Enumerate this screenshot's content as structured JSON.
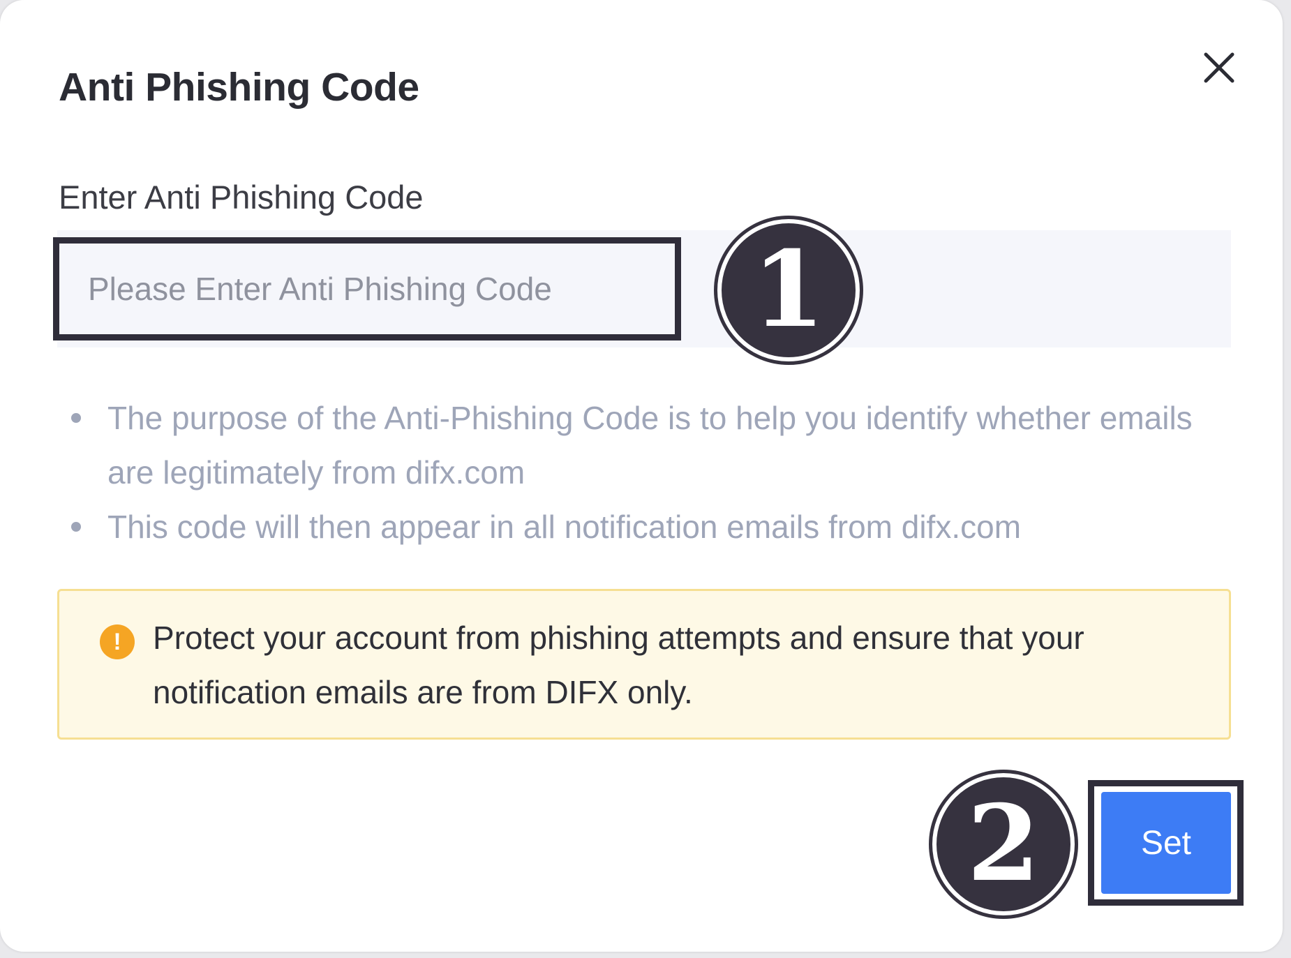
{
  "dialog": {
    "title": "Anti Phishing Code",
    "close_icon": "close-icon"
  },
  "form": {
    "label": "Enter Anti Phishing Code",
    "input_value": "",
    "input_placeholder": "Please Enter Anti Phishing Code"
  },
  "info": {
    "items": [
      "The purpose of the Anti-Phishing Code is to help you identify whether emails are legitimately from difx.com",
      "This code will then appear in all notification emails from difx.com"
    ]
  },
  "warning": {
    "icon": "warning-icon",
    "icon_glyph": "!",
    "text": "Protect your account from phishing attempts and ensure that your notification emails are from DIFX only."
  },
  "actions": {
    "set_label": "Set"
  },
  "annotations": {
    "step_1": "1",
    "step_2": "2"
  },
  "colors": {
    "primary_button": "#3d7cf5",
    "warning_bg": "#fef9e6",
    "warning_border": "#f6df92",
    "warning_icon": "#f5a524",
    "annotation": "#36323f"
  }
}
